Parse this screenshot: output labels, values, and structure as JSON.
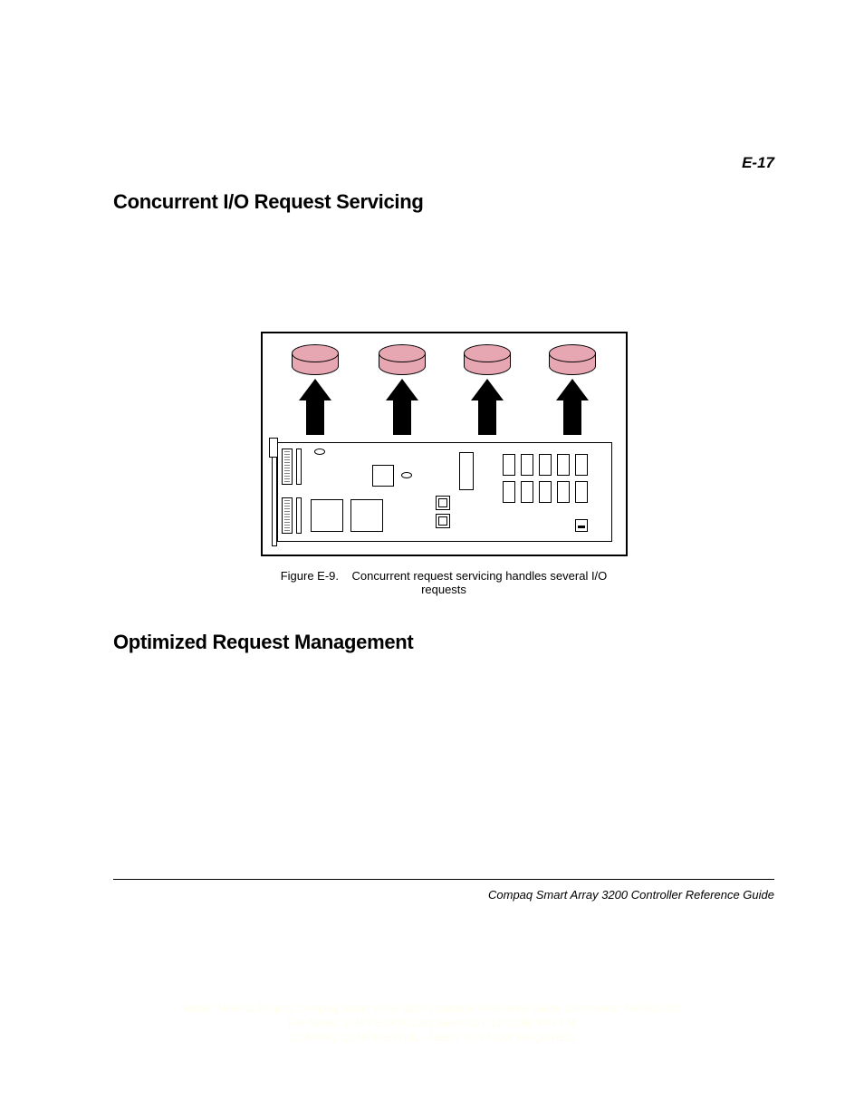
{
  "page_number": "E-17",
  "headings": {
    "h1": "Concurrent I/O Request Servicing",
    "h2": "Optimized Request Management"
  },
  "figure": {
    "label": "Figure E-9.",
    "caption": "Concurrent request servicing handles several I/O requests"
  },
  "footer": "Compaq Smart Array 3200 Controller Reference Guide",
  "imprint": {
    "line1": "Writer: Melissa  Project: Compaq Smart Array 3200 Controller Reference Guide  Comments: 340862-002",
    "line2": "File Name: L-APPE.DOC  Last Saved On: 12/21/98 4:05 PM",
    "line3": "COMPAQ CONFIDENTIAL - NEED TO KNOW REQUIRED"
  }
}
